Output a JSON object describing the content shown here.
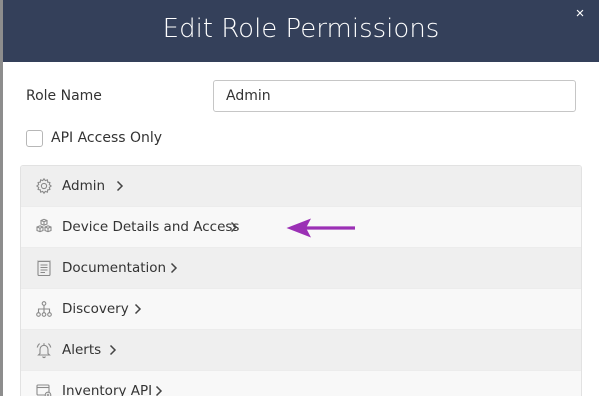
{
  "dialog": {
    "title": "Edit Role Permissions",
    "close_glyph": "×"
  },
  "form": {
    "role_name_label": "Role Name",
    "role_name_value": "Admin",
    "api_access_label": "API Access Only",
    "api_access_checked": false
  },
  "permissions": [
    {
      "label": "Admin",
      "icon": "gear-icon"
    },
    {
      "label": "Device Details and Access",
      "icon": "cubes-icon"
    },
    {
      "label": "Documentation",
      "icon": "document-icon"
    },
    {
      "label": "Discovery",
      "icon": "network-icon"
    },
    {
      "label": "Alerts",
      "icon": "bell-icon"
    },
    {
      "label": "Inventory API",
      "icon": "api-icon"
    }
  ],
  "annotation": {
    "arrow_color": "#9b30b5",
    "points_to": "Device Details and Access"
  },
  "colors": {
    "header_bg": "#34405a",
    "row_odd": "#efefef",
    "row_even": "#f8f8f8"
  }
}
